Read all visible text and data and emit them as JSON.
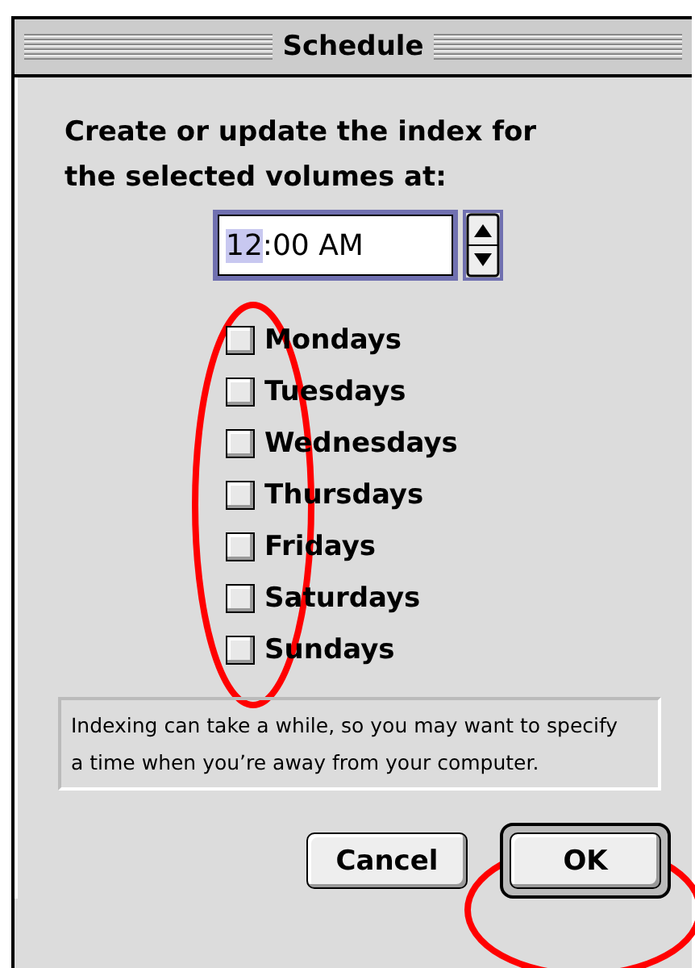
{
  "window": {
    "title": "Schedule"
  },
  "prompt": "Create or update the index for the selected volumes at:",
  "time_field": {
    "hour": "12",
    "rest": ":00 AM",
    "hour_selected": true
  },
  "days": [
    {
      "label": "Mondays",
      "checked": false
    },
    {
      "label": "Tuesdays",
      "checked": false
    },
    {
      "label": "Wednesdays",
      "checked": false
    },
    {
      "label": "Thursdays",
      "checked": false
    },
    {
      "label": "Fridays",
      "checked": false
    },
    {
      "label": "Saturdays",
      "checked": false
    },
    {
      "label": "Sundays",
      "checked": false
    }
  ],
  "note": "Indexing can take a while, so you may want to specify a time when you’re away from your computer.",
  "buttons": [
    {
      "label": "Cancel",
      "default": false
    },
    {
      "label": "OK",
      "default": true
    }
  ],
  "annotations": [
    {
      "kind": "ellipse"
    },
    {
      "kind": "ellipse"
    }
  ]
}
